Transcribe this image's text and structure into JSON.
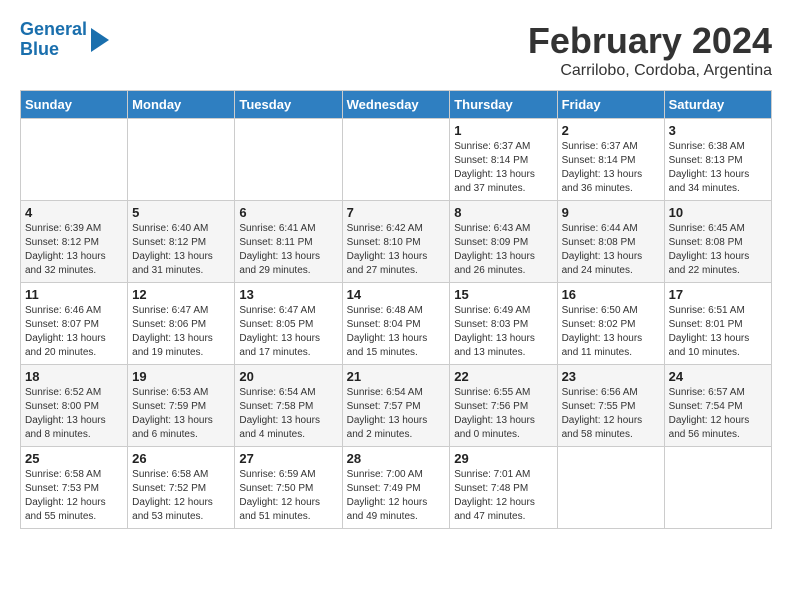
{
  "header": {
    "logo_line1": "General",
    "logo_line2": "Blue",
    "title": "February 2024",
    "location": "Carrilobo, Cordoba, Argentina"
  },
  "weekdays": [
    "Sunday",
    "Monday",
    "Tuesday",
    "Wednesday",
    "Thursday",
    "Friday",
    "Saturday"
  ],
  "weeks": [
    [
      {
        "day": "",
        "info": ""
      },
      {
        "day": "",
        "info": ""
      },
      {
        "day": "",
        "info": ""
      },
      {
        "day": "",
        "info": ""
      },
      {
        "day": "1",
        "info": "Sunrise: 6:37 AM\nSunset: 8:14 PM\nDaylight: 13 hours and 37 minutes."
      },
      {
        "day": "2",
        "info": "Sunrise: 6:37 AM\nSunset: 8:14 PM\nDaylight: 13 hours and 36 minutes."
      },
      {
        "day": "3",
        "info": "Sunrise: 6:38 AM\nSunset: 8:13 PM\nDaylight: 13 hours and 34 minutes."
      }
    ],
    [
      {
        "day": "4",
        "info": "Sunrise: 6:39 AM\nSunset: 8:12 PM\nDaylight: 13 hours and 32 minutes."
      },
      {
        "day": "5",
        "info": "Sunrise: 6:40 AM\nSunset: 8:12 PM\nDaylight: 13 hours and 31 minutes."
      },
      {
        "day": "6",
        "info": "Sunrise: 6:41 AM\nSunset: 8:11 PM\nDaylight: 13 hours and 29 minutes."
      },
      {
        "day": "7",
        "info": "Sunrise: 6:42 AM\nSunset: 8:10 PM\nDaylight: 13 hours and 27 minutes."
      },
      {
        "day": "8",
        "info": "Sunrise: 6:43 AM\nSunset: 8:09 PM\nDaylight: 13 hours and 26 minutes."
      },
      {
        "day": "9",
        "info": "Sunrise: 6:44 AM\nSunset: 8:08 PM\nDaylight: 13 hours and 24 minutes."
      },
      {
        "day": "10",
        "info": "Sunrise: 6:45 AM\nSunset: 8:08 PM\nDaylight: 13 hours and 22 minutes."
      }
    ],
    [
      {
        "day": "11",
        "info": "Sunrise: 6:46 AM\nSunset: 8:07 PM\nDaylight: 13 hours and 20 minutes."
      },
      {
        "day": "12",
        "info": "Sunrise: 6:47 AM\nSunset: 8:06 PM\nDaylight: 13 hours and 19 minutes."
      },
      {
        "day": "13",
        "info": "Sunrise: 6:47 AM\nSunset: 8:05 PM\nDaylight: 13 hours and 17 minutes."
      },
      {
        "day": "14",
        "info": "Sunrise: 6:48 AM\nSunset: 8:04 PM\nDaylight: 13 hours and 15 minutes."
      },
      {
        "day": "15",
        "info": "Sunrise: 6:49 AM\nSunset: 8:03 PM\nDaylight: 13 hours and 13 minutes."
      },
      {
        "day": "16",
        "info": "Sunrise: 6:50 AM\nSunset: 8:02 PM\nDaylight: 13 hours and 11 minutes."
      },
      {
        "day": "17",
        "info": "Sunrise: 6:51 AM\nSunset: 8:01 PM\nDaylight: 13 hours and 10 minutes."
      }
    ],
    [
      {
        "day": "18",
        "info": "Sunrise: 6:52 AM\nSunset: 8:00 PM\nDaylight: 13 hours and 8 minutes."
      },
      {
        "day": "19",
        "info": "Sunrise: 6:53 AM\nSunset: 7:59 PM\nDaylight: 13 hours and 6 minutes."
      },
      {
        "day": "20",
        "info": "Sunrise: 6:54 AM\nSunset: 7:58 PM\nDaylight: 13 hours and 4 minutes."
      },
      {
        "day": "21",
        "info": "Sunrise: 6:54 AM\nSunset: 7:57 PM\nDaylight: 13 hours and 2 minutes."
      },
      {
        "day": "22",
        "info": "Sunrise: 6:55 AM\nSunset: 7:56 PM\nDaylight: 13 hours and 0 minutes."
      },
      {
        "day": "23",
        "info": "Sunrise: 6:56 AM\nSunset: 7:55 PM\nDaylight: 12 hours and 58 minutes."
      },
      {
        "day": "24",
        "info": "Sunrise: 6:57 AM\nSunset: 7:54 PM\nDaylight: 12 hours and 56 minutes."
      }
    ],
    [
      {
        "day": "25",
        "info": "Sunrise: 6:58 AM\nSunset: 7:53 PM\nDaylight: 12 hours and 55 minutes."
      },
      {
        "day": "26",
        "info": "Sunrise: 6:58 AM\nSunset: 7:52 PM\nDaylight: 12 hours and 53 minutes."
      },
      {
        "day": "27",
        "info": "Sunrise: 6:59 AM\nSunset: 7:50 PM\nDaylight: 12 hours and 51 minutes."
      },
      {
        "day": "28",
        "info": "Sunrise: 7:00 AM\nSunset: 7:49 PM\nDaylight: 12 hours and 49 minutes."
      },
      {
        "day": "29",
        "info": "Sunrise: 7:01 AM\nSunset: 7:48 PM\nDaylight: 12 hours and 47 minutes."
      },
      {
        "day": "",
        "info": ""
      },
      {
        "day": "",
        "info": ""
      }
    ]
  ]
}
